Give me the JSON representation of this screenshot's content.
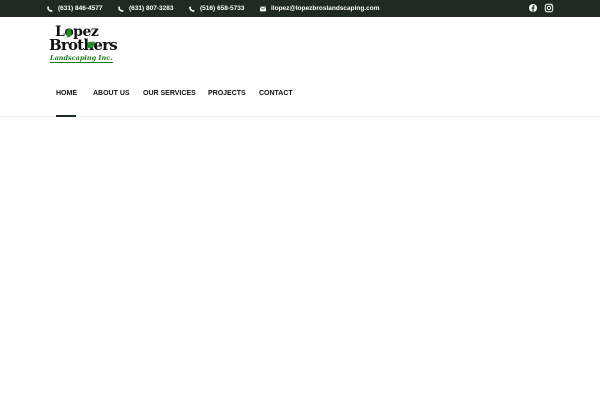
{
  "topbar": {
    "contacts": [
      {
        "icon": "phone-icon",
        "text": "(631) 846-4577"
      },
      {
        "icon": "phone-icon",
        "text": "(631) 807-3283"
      },
      {
        "icon": "phone-icon",
        "text": "(516) 658-5733"
      },
      {
        "icon": "email-icon",
        "text": "ilopez@lopezbroslandscaping.com"
      }
    ],
    "social": [
      "facebook-icon",
      "instagram-icon"
    ]
  },
  "logo": {
    "line1": "Lopez",
    "line2": "Brothers",
    "line3": "Landscaping Inc.",
    "color_green": "#1b7a1b"
  },
  "nav": {
    "items": [
      "HOME",
      "ABOUT US",
      "OUR SERVICES",
      "PROJECTS",
      "CONTACT"
    ],
    "active": "HOME"
  },
  "colors": {
    "topbar_bg": "#1f2a22",
    "text": "#111111"
  }
}
